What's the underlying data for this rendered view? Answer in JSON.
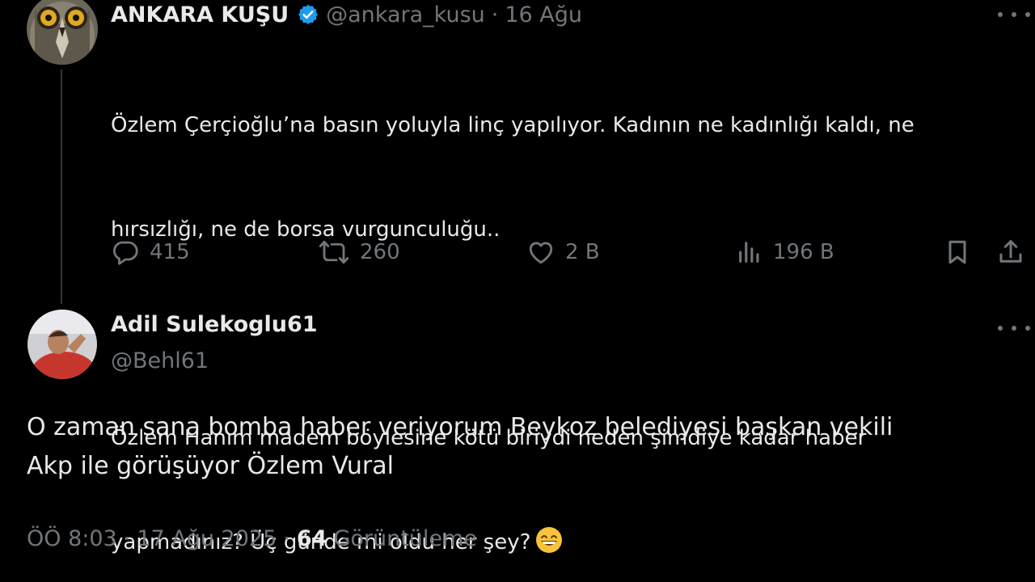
{
  "tweet": {
    "author": {
      "display_name": "ANKARA KUŞU",
      "handle": "@ankara_kusu",
      "verified": true
    },
    "date": "16 Ağu",
    "text_lines": [
      "Özlem Çerçioğlu’na basın yoluyla linç yapılıyor. Kadının ne kadınlığı kaldı, ne",
      "hırsızlığı, ne de borsa vurgunculuğu..",
      "Özlem Hanım madem böylesine kötü biriydi neden şimdiye kadar haber",
      "yapmadınız? Üç günde mi oldu her şey?"
    ],
    "emoji": "grinning-face-with-smiling-eyes",
    "stats": {
      "replies": "415",
      "retweets": "260",
      "likes": "2 B",
      "views": "196 B"
    }
  },
  "reply": {
    "author": {
      "display_name": "Adil Sulekoglu61",
      "handle": "@Behl61"
    },
    "text_lines": [
      "O zaman sana bomba haber veriyorum Beykoz belediyesi başkan vekili",
      "Akp ile görüşüyor Özlem Vural"
    ],
    "meta": {
      "time": "ÖÖ 8:03",
      "date": "17 Ağu 2025",
      "view_count": "64",
      "view_label": "Görüntüleme"
    }
  },
  "icons": {
    "verified": "verified-badge-icon",
    "more": "more-options-icon",
    "reply": "reply-icon",
    "retweet": "retweet-icon",
    "like": "heart-icon",
    "views": "views-chart-icon",
    "bookmark": "bookmark-icon",
    "share": "share-icon"
  },
  "colors": {
    "background": "#000000",
    "text": "#e7e9ea",
    "muted": "#71767b",
    "verified": "#1d9bf0",
    "thread_line": "#333639"
  }
}
